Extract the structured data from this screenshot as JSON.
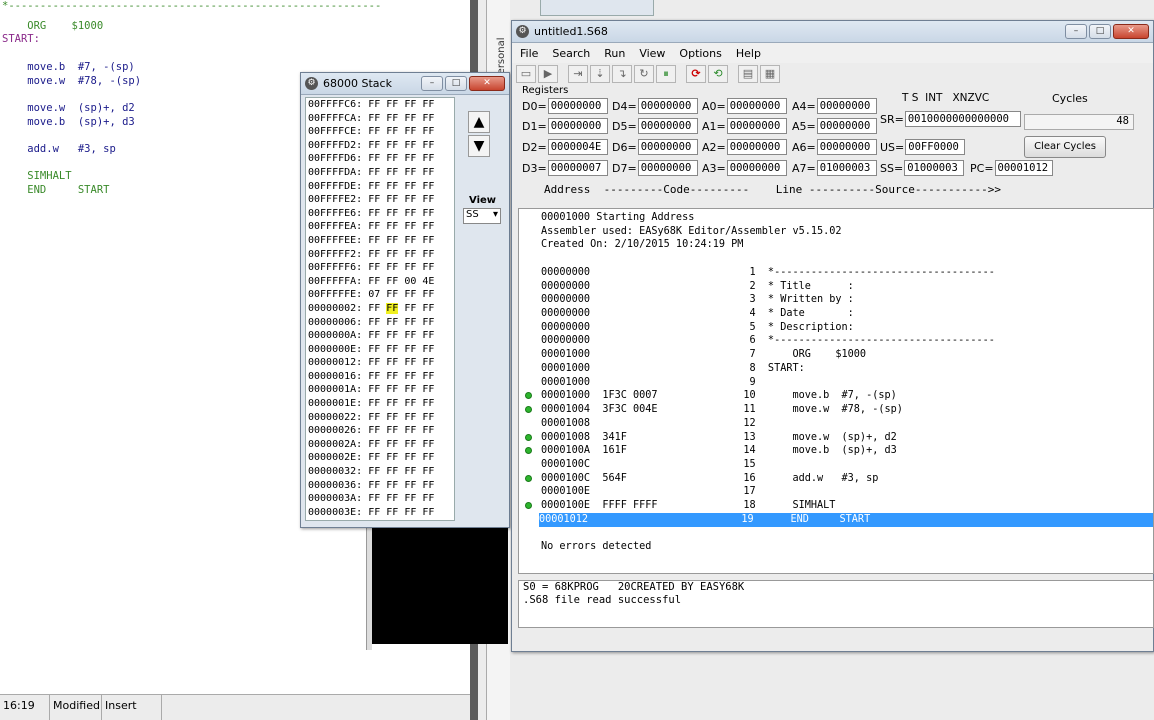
{
  "editor": {
    "lines": [
      {
        "text": "*-----------------------------------------------------------",
        "cls": "kw-green"
      },
      {
        "text": "    ORG    $1000",
        "cls": "kw-green"
      },
      {
        "text": "START:",
        "cls": "kw-purple"
      },
      {
        "text": "",
        "cls": ""
      },
      {
        "text": "    move.b  #7, -(sp)",
        "cls": "kw-blue"
      },
      {
        "text": "    move.w  #78, -(sp)",
        "cls": "kw-blue"
      },
      {
        "text": "",
        "cls": ""
      },
      {
        "text": "    move.w  (sp)+, d2",
        "cls": "kw-blue"
      },
      {
        "text": "    move.b  (sp)+, d3",
        "cls": "kw-blue"
      },
      {
        "text": "",
        "cls": ""
      },
      {
        "text": "    add.w   #3, sp",
        "cls": "kw-blue"
      },
      {
        "text": "",
        "cls": ""
      },
      {
        "text": "    SIMHALT",
        "cls": "kw-green"
      },
      {
        "text": "    END     START",
        "cls": "kw-green"
      }
    ],
    "status": {
      "position": "16:19",
      "modified": "Modified",
      "mode": "Insert"
    }
  },
  "personal_label": "Personal",
  "stack_window": {
    "title": "68000 Stack",
    "rows": [
      "00FFFFC6: FF FF FF FF",
      "00FFFFCA: FF FF FF FF",
      "00FFFFCE: FF FF FF FF",
      "00FFFFD2: FF FF FF FF",
      "00FFFFD6: FF FF FF FF",
      "00FFFFDA: FF FF FF FF",
      "00FFFFDE: FF FF FF FF",
      "00FFFFE2: FF FF FF FF",
      "00FFFFE6: FF FF FF FF",
      "00FFFFEA: FF FF FF FF",
      "00FFFFEE: FF FF FF FF",
      "00FFFFF2: FF FF FF FF",
      "00FFFFF6: FF FF FF FF",
      "00FFFFFA: FF FF 00 4E",
      "00FFFFFE: 07 FF FF FF",
      "00000002: FF ",
      "00000006: FF FF FF FF",
      "0000000A: FF FF FF FF",
      "0000000E: FF FF FF FF",
      "00000012: FF FF FF FF",
      "00000016: FF FF FF FF",
      "0000001A: FF FF FF FF",
      "0000001E: FF FF FF FF",
      "00000022: FF FF FF FF",
      "00000026: FF FF FF FF",
      "0000002A: FF FF FF FF",
      "0000002E: FF FF FF FF",
      "00000032: FF FF FF FF",
      "00000036: FF FF FF FF",
      "0000003A: FF FF FF FF",
      "0000003E: FF FF FF FF"
    ],
    "highlight_byte": "FF",
    "highlight_rest": " FF FF",
    "view_label": "View",
    "view_value": "SS"
  },
  "main_window": {
    "title": "untitled1.S68",
    "menu": [
      "File",
      "Search",
      "Run",
      "View",
      "Options",
      "Help"
    ],
    "registers_label": "Registers",
    "regs": {
      "D0": "00000000",
      "D1": "00000000",
      "D2": "0000004E",
      "D3": "00000007",
      "D4": "00000000",
      "D5": "00000000",
      "D6": "00000000",
      "D7": "00000000",
      "A0": "00000000",
      "A1": "00000000",
      "A2": "00000000",
      "A3": "00000000",
      "A4": "00000000",
      "A5": "00000000",
      "A6": "00000000",
      "A7": "01000003",
      "SR": "0010000000000000",
      "US": "00FF0000",
      "SS": "01000003",
      "PC": "00001012"
    },
    "sr_header": "T S  INT   XNZVC",
    "cycles_label": "Cycles",
    "cycles_value": "48",
    "clear_cycles": "Clear Cycles",
    "column_header": "Address  ---------Code---------    Line ----------Source----------->>",
    "listing": [
      {
        "text": "00001000 Starting Address",
        "dot": false
      },
      {
        "text": "Assembler used: EASy68K Editor/Assembler v5.15.02",
        "dot": false
      },
      {
        "text": "Created On: 2/10/2015 10:24:19 PM",
        "dot": false
      },
      {
        "text": "",
        "dot": false
      },
      {
        "text": "00000000                          1  *------------------------------------",
        "dot": false
      },
      {
        "text": "00000000                          2  * Title      :",
        "dot": false
      },
      {
        "text": "00000000                          3  * Written by :",
        "dot": false
      },
      {
        "text": "00000000                          4  * Date       :",
        "dot": false
      },
      {
        "text": "00000000                          5  * Description:",
        "dot": false
      },
      {
        "text": "00000000                          6  *------------------------------------",
        "dot": false
      },
      {
        "text": "00001000                          7      ORG    $1000",
        "dot": false
      },
      {
        "text": "00001000                          8  START:",
        "dot": false
      },
      {
        "text": "00001000                          9",
        "dot": false
      },
      {
        "text": "00001000  1F3C 0007              10      move.b  #7, -(sp)",
        "dot": true
      },
      {
        "text": "00001004  3F3C 004E              11      move.w  #78, -(sp)",
        "dot": true
      },
      {
        "text": "00001008                         12",
        "dot": false
      },
      {
        "text": "00001008  341F                   13      move.w  (sp)+, d2",
        "dot": true
      },
      {
        "text": "0000100A  161F                   14      move.b  (sp)+, d3",
        "dot": true
      },
      {
        "text": "0000100C                         15",
        "dot": false
      },
      {
        "text": "0000100C  564F                   16      add.w   #3, sp",
        "dot": true
      },
      {
        "text": "0000100E                         17",
        "dot": false
      },
      {
        "text": "0000100E  FFFF FFFF              18      SIMHALT",
        "dot": true
      },
      {
        "text": "00001012                         19      END     START",
        "dot": false,
        "selected": true
      },
      {
        "text": "",
        "dot": false
      },
      {
        "text": "No errors detected",
        "dot": false
      }
    ],
    "messages": [
      "S0 = 68KPROG   20CREATED BY EASY68K",
      ".S68 file read successful"
    ]
  }
}
